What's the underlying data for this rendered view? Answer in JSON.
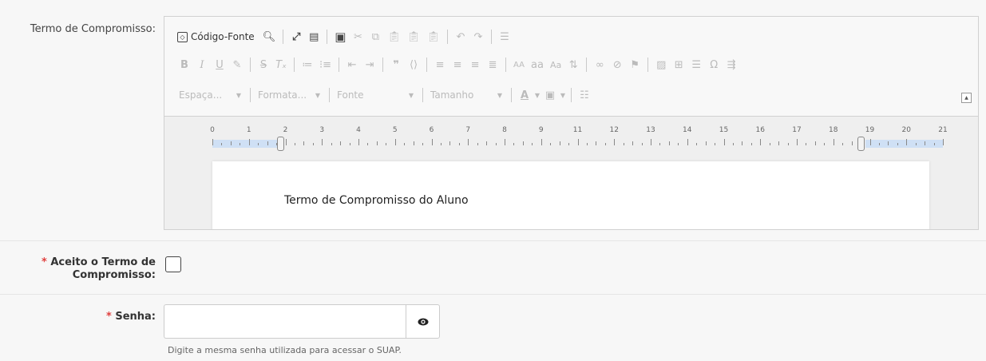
{
  "field_term": {
    "label": "Termo de Compromisso:"
  },
  "editor": {
    "toolbar": {
      "source_label": "Código-Fonte",
      "combos": {
        "spacing": "Espaça...",
        "format": "Formata...",
        "font": "Fonte",
        "size": "Tamanho"
      },
      "text_case_upper": "AA",
      "text_case_lower": "aa",
      "text_case_title": "Aa"
    },
    "ruler": [
      "0",
      "1",
      "2",
      "3",
      "4",
      "5",
      "6",
      "7",
      "8",
      "9",
      "11",
      "12",
      "13",
      "14",
      "15",
      "16",
      "17",
      "18",
      "19",
      "20",
      "21"
    ],
    "document_title": "Termo de Compromisso do Aluno"
  },
  "field_accept": {
    "required_mark": "*",
    "label_line1": "Aceito o Termo de",
    "label_line2": "Compromisso:"
  },
  "field_password": {
    "required_mark": "*",
    "label": "Senha:",
    "value": "",
    "help": "Digite a mesma senha utilizada para acessar o SUAP."
  },
  "colors": {
    "required": "#e0403f",
    "ruler_margin": "#cfe0f5"
  }
}
